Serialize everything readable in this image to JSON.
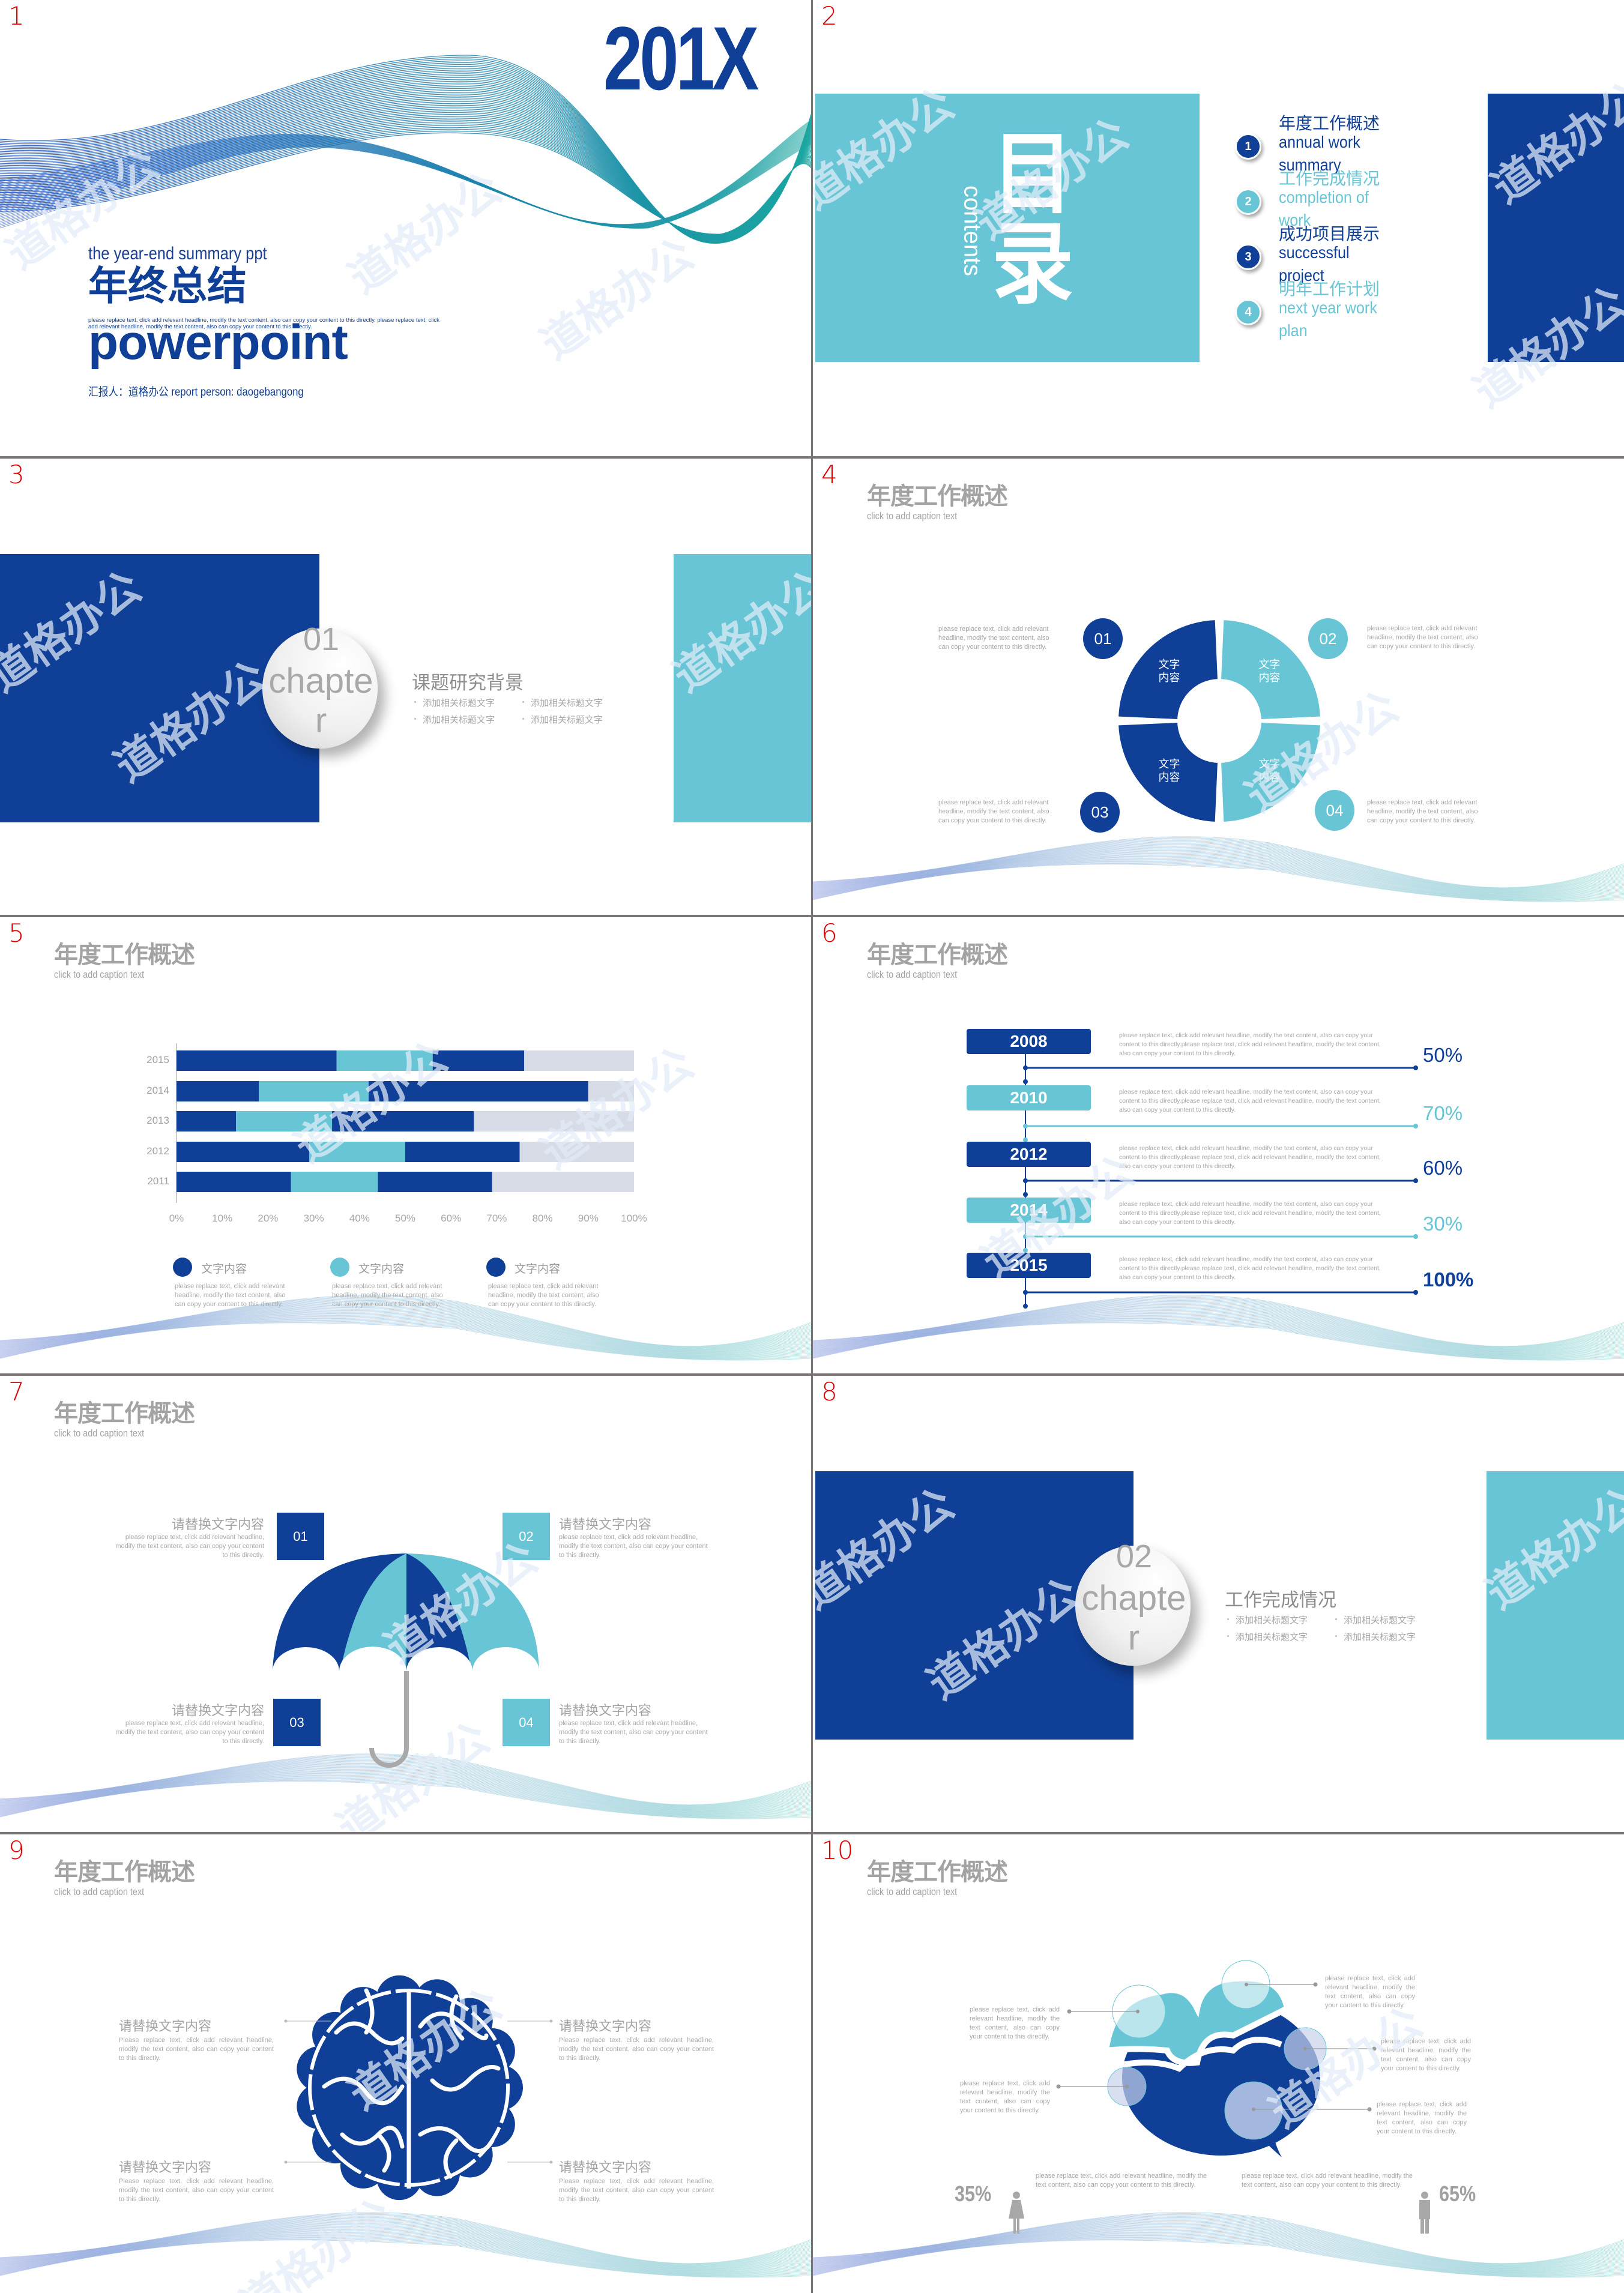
{
  "watermark": "道格办公",
  "colors": {
    "dark": "#0f3f96",
    "light": "#68c5d5",
    "bar_rest": "#d8dce6",
    "text_gray": "#a3a3a3",
    "slide_number": "#e00000",
    "handle": "#a9a9a9"
  },
  "slide_numbers": [
    "1",
    "2",
    "3",
    "4",
    "5",
    "6",
    "7",
    "8",
    "9",
    "10"
  ],
  "common": {
    "section_title": "年度工作概述",
    "caption": "click to add caption text",
    "para": "please replace text, click add relevant headline, modify the text content, also can copy your content to this directly."
  },
  "slide1": {
    "year": "201X",
    "subtitle_en": "the year-end summary ppt",
    "title_cn": "年终总结",
    "body": "please replace text, click add relevant headline, modify the text content, also can copy your content to this directly. please replace text, click add relevant headline, modify the text content, also can copy your content to this directly.",
    "title_en": "powerpoint",
    "reporter": "汇报人：道格办公  report person: daogebangong"
  },
  "slide2": {
    "title_cn_1": "目",
    "title_cn_2": "录",
    "title_en": "contents",
    "items": [
      {
        "num": "1",
        "cn": "年度工作概述",
        "en": "annual work summary"
      },
      {
        "num": "2",
        "cn": "工作完成情况",
        "en": "completion of work"
      },
      {
        "num": "3",
        "cn": "成功项目展示",
        "en": "successful project"
      },
      {
        "num": "4",
        "cn": "明年工作计划",
        "en": "next year work plan"
      }
    ]
  },
  "slide3": {
    "chapter_num": "01",
    "chapter_word": "chapter",
    "title": "课题研究背景",
    "bullets": [
      "添加相关标题文字",
      "添加相关标题文字",
      "添加相关标题文字",
      "添加相关标题文字"
    ]
  },
  "slide4": {
    "segment_label": "文字内容",
    "steps": [
      {
        "num": "01",
        "text": "please replace text, click add relevant headline, modify the text content, also can copy your content to this directly."
      },
      {
        "num": "02",
        "text": "please replace text, click add relevant headline, modify the text content, also can copy your content to this directly."
      },
      {
        "num": "03",
        "text": "please replace text, click add relevant headline, modify the text content, also can copy your content to this directly."
      },
      {
        "num": "04",
        "text": "please replace text, click add relevant headline, modify the text content, also can copy your content to this directly."
      }
    ]
  },
  "chart_data": {
    "type": "bar",
    "orientation": "horizontal",
    "stacked": true,
    "categories": [
      "2015",
      "2014",
      "2013",
      "2012",
      "2011"
    ],
    "series": [
      {
        "values": [
          35,
          18,
          13,
          29,
          25
        ],
        "color": "#0f3f96"
      },
      {
        "values": [
          21,
          24,
          21,
          21,
          19
        ],
        "color": "#68c5d5"
      },
      {
        "values": [
          20,
          48,
          31,
          25,
          25
        ],
        "color": "#0f3f96"
      },
      {
        "values": [
          24,
          10,
          35,
          25,
          31
        ],
        "color": "#d8dce6"
      }
    ],
    "xlim": [
      0,
      100
    ],
    "xticks": [
      "0%",
      "10%",
      "20%",
      "30%",
      "40%",
      "50%",
      "60%",
      "70%",
      "80%",
      "90%",
      "100%"
    ],
    "grid": false,
    "legend_placement": "bottom",
    "legend": [
      {
        "label": "文字内容",
        "color": "#0f3f96",
        "text": "please replace text, click add relevant headline, modify the text content, also can copy your content to this directly."
      },
      {
        "label": "文字内容",
        "color": "#68c5d5",
        "text": "please replace text, click add relevant headline, modify the text content, also can copy your content to this directly."
      },
      {
        "label": "文字内容",
        "color": "#0f3f96",
        "text": "please replace text, click add relevant headline, modify the text content, also can copy your content to this directly."
      }
    ]
  },
  "slide6": {
    "timeline": [
      {
        "year": "2008",
        "percent": "50%",
        "text": "please replace text, click add relevant headline, modify the text content, also can copy your content to this directly.please replace text, click add relevant headline, modify the text content, also can copy your content to this directly."
      },
      {
        "year": "2010",
        "percent": "70%",
        "text": "please replace text, click add relevant headline, modify the text content, also can copy your content to this directly.please replace text, click add relevant headline, modify the text content, also can copy your content to this directly."
      },
      {
        "year": "2012",
        "percent": "60%",
        "text": "please replace text, click add relevant headline, modify the text content, also can copy your content to this directly.please replace text, click add relevant headline, modify the text content, also can copy your content to this directly."
      },
      {
        "year": "2014",
        "percent": "30%",
        "text": "please replace text, click add relevant headline, modify the text content, also can copy your content to this directly.please replace text, click add relevant headline, modify the text content, also can copy your content to this directly."
      },
      {
        "year": "2015",
        "percent": "100%",
        "text": "please replace text, click add relevant headline, modify the text content, also can copy your content to this directly.please replace text, click add relevant headline, modify the text content, also can copy your content to this directly."
      }
    ]
  },
  "slide7": {
    "items": [
      {
        "num": "01",
        "heading": "请替换文字内容",
        "text": "please replace text, click add relevant headline, modify the text content, also can copy your content to this directly."
      },
      {
        "num": "02",
        "heading": "请替换文字内容",
        "text": "please replace text, click add relevant headline, modify the text content, also can copy your content to this directly."
      },
      {
        "num": "03",
        "heading": "请替换文字内容",
        "text": "please replace text, click add relevant headline, modify the text content, also can copy your content to this directly."
      },
      {
        "num": "04",
        "heading": "请替换文字内容",
        "text": "please replace text, click add relevant headline, modify the text content, also can copy your content to this directly."
      }
    ]
  },
  "slide8": {
    "chapter_num": "02",
    "chapter_word": "chapter",
    "title": "工作完成情况",
    "bullets": [
      "添加相关标题文字",
      "添加相关标题文字",
      "添加相关标题文字",
      "添加相关标题文字"
    ]
  },
  "slide9": {
    "items": [
      {
        "heading": "请替换文字内容",
        "text": "Please replace text, click add relevant headline, modify the text content, also can copy your content to this directly."
      },
      {
        "heading": "请替换文字内容",
        "text": "Please replace text, click add relevant headline, modify the text content, also can copy your content to this directly."
      },
      {
        "heading": "请替换文字内容",
        "text": "Please replace text, click add relevant headline, modify the text content, also can copy your content to this directly."
      },
      {
        "heading": "请替换文字内容",
        "text": "Please replace text, click add relevant headline, modify the text content, also can copy your content to this directly."
      }
    ]
  },
  "slide10": {
    "callouts": [
      "please replace text, click add relevant headline, modify the text content, also can copy your content to this directly.",
      "please replace text, click add relevant headline, modify the text content, also can copy your content to this directly.",
      "please replace text, click add relevant headline, modify the text content, also can copy your content to this directly.",
      "please replace text, click add relevant headline, modify the text content, also can copy your content to this directly.",
      "please replace text, click add relevant headline, modify the text content, also can copy your content to this directly."
    ],
    "stats": [
      {
        "value": "35%",
        "icon": "female-icon",
        "text": "please replace text, click add relevant headline, modify the text content, also can copy your content to this directly."
      },
      {
        "value": "65%",
        "icon": "male-icon",
        "text": "please replace text, click add relevant headline, modify the text content, also can copy your content to this directly."
      }
    ]
  }
}
